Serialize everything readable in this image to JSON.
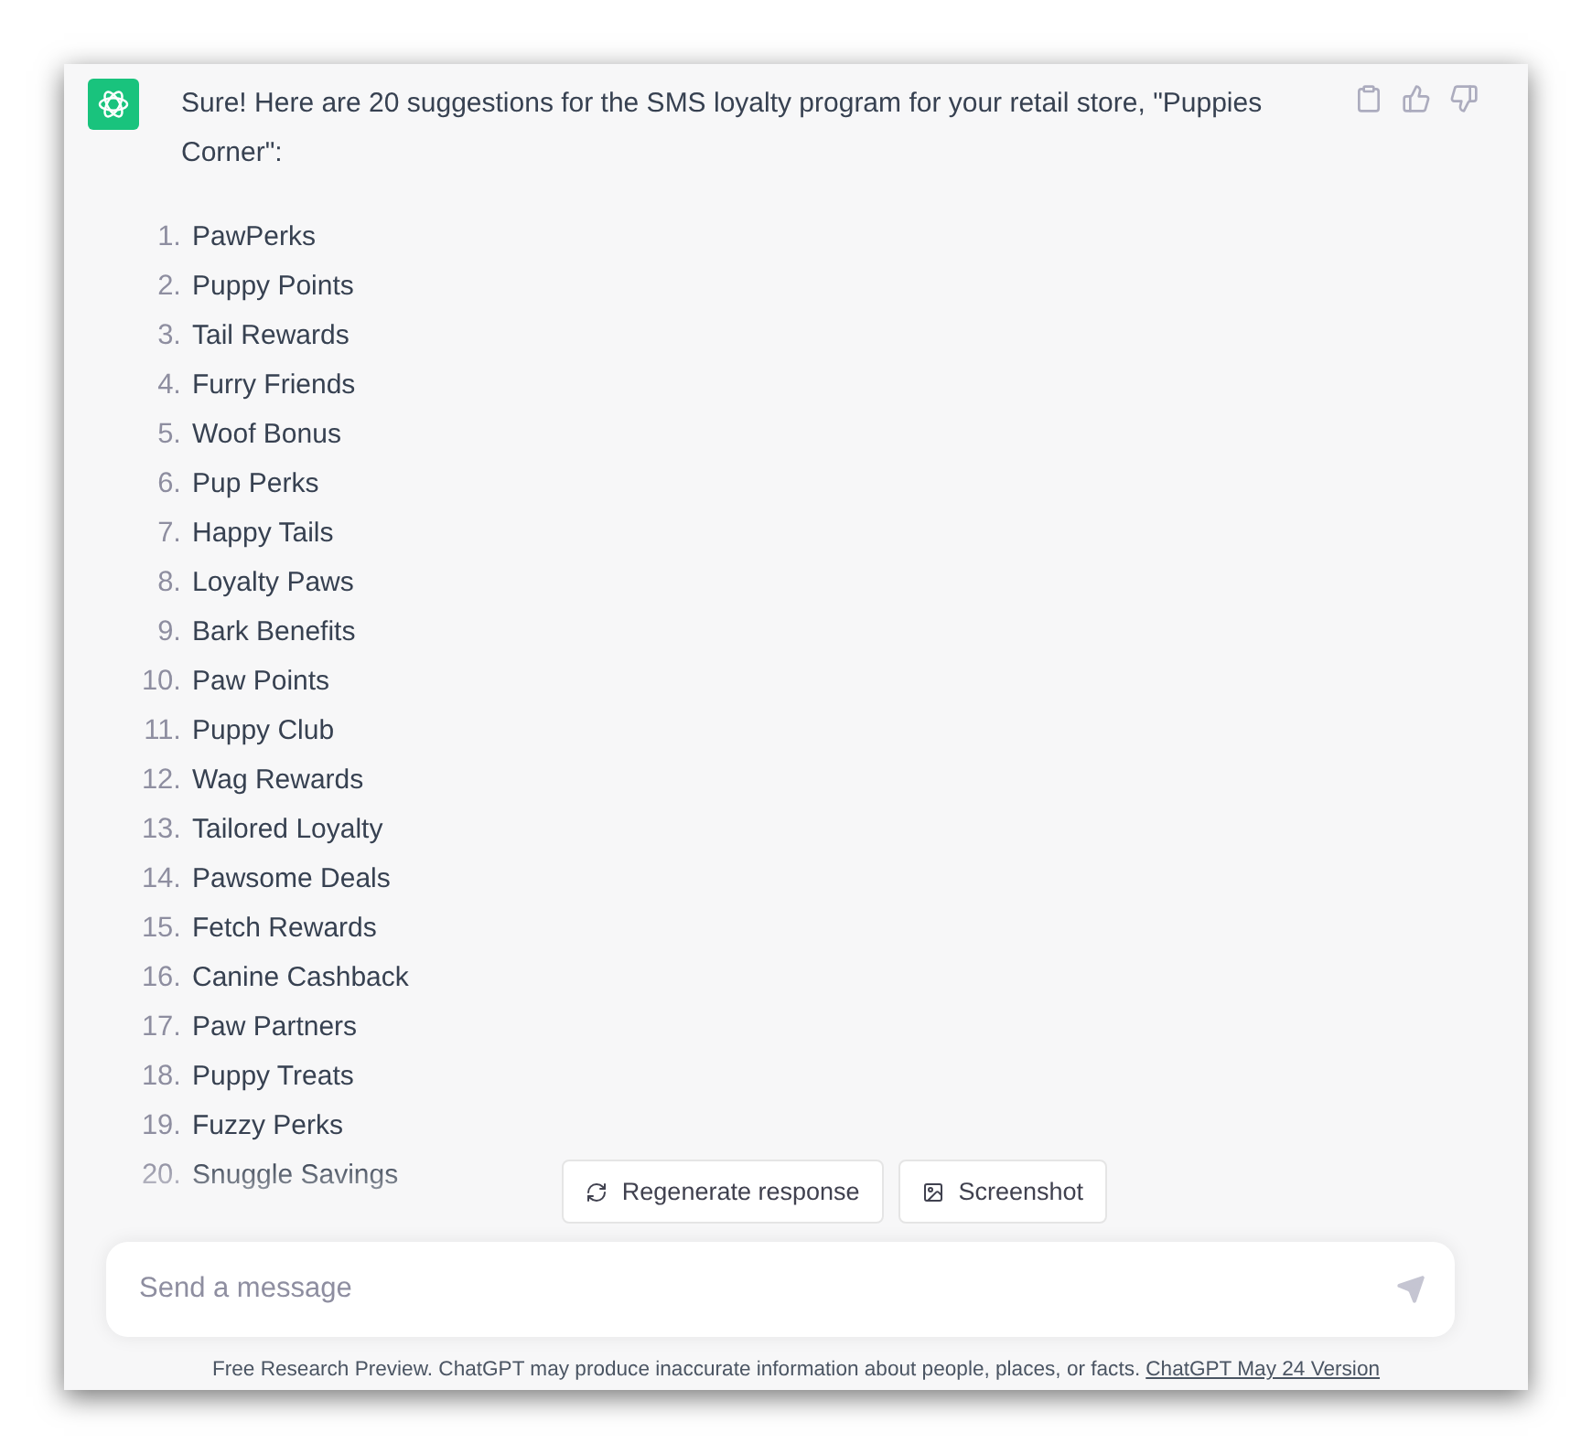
{
  "message": {
    "intro": "Sure! Here are 20 suggestions for the SMS loyalty program for your retail store, \"Puppies Corner\":",
    "items": [
      {
        "number": "1.",
        "text": "PawPerks"
      },
      {
        "number": "2.",
        "text": "Puppy Points"
      },
      {
        "number": "3.",
        "text": "Tail Rewards"
      },
      {
        "number": "4.",
        "text": "Furry Friends"
      },
      {
        "number": "5.",
        "text": "Woof Bonus"
      },
      {
        "number": "6.",
        "text": "Pup Perks"
      },
      {
        "number": "7.",
        "text": "Happy Tails"
      },
      {
        "number": "8.",
        "text": "Loyalty Paws"
      },
      {
        "number": "9.",
        "text": "Bark Benefits"
      },
      {
        "number": "10.",
        "text": "Paw Points"
      },
      {
        "number": "11.",
        "text": "Puppy Club"
      },
      {
        "number": "12.",
        "text": "Wag Rewards"
      },
      {
        "number": "13.",
        "text": "Tailored Loyalty"
      },
      {
        "number": "14.",
        "text": "Pawsome Deals"
      },
      {
        "number": "15.",
        "text": "Fetch Rewards"
      },
      {
        "number": "16.",
        "text": "Canine Cashback"
      },
      {
        "number": "17.",
        "text": "Paw Partners"
      },
      {
        "number": "18.",
        "text": "Puppy Treats"
      },
      {
        "number": "19.",
        "text": "Fuzzy Perks"
      },
      {
        "number": "20.",
        "text": "Snuggle Savings"
      }
    ]
  },
  "actions": [
    {
      "kind": "regenerate",
      "label": "Regenerate response"
    },
    {
      "kind": "screenshot",
      "label": "Screenshot"
    }
  ],
  "composer": {
    "placeholder": "Send a message"
  },
  "footer": {
    "text": "Free Research Preview. ChatGPT may produce inaccurate information about people, places, or facts.",
    "link": "ChatGPT May 24 Version"
  }
}
